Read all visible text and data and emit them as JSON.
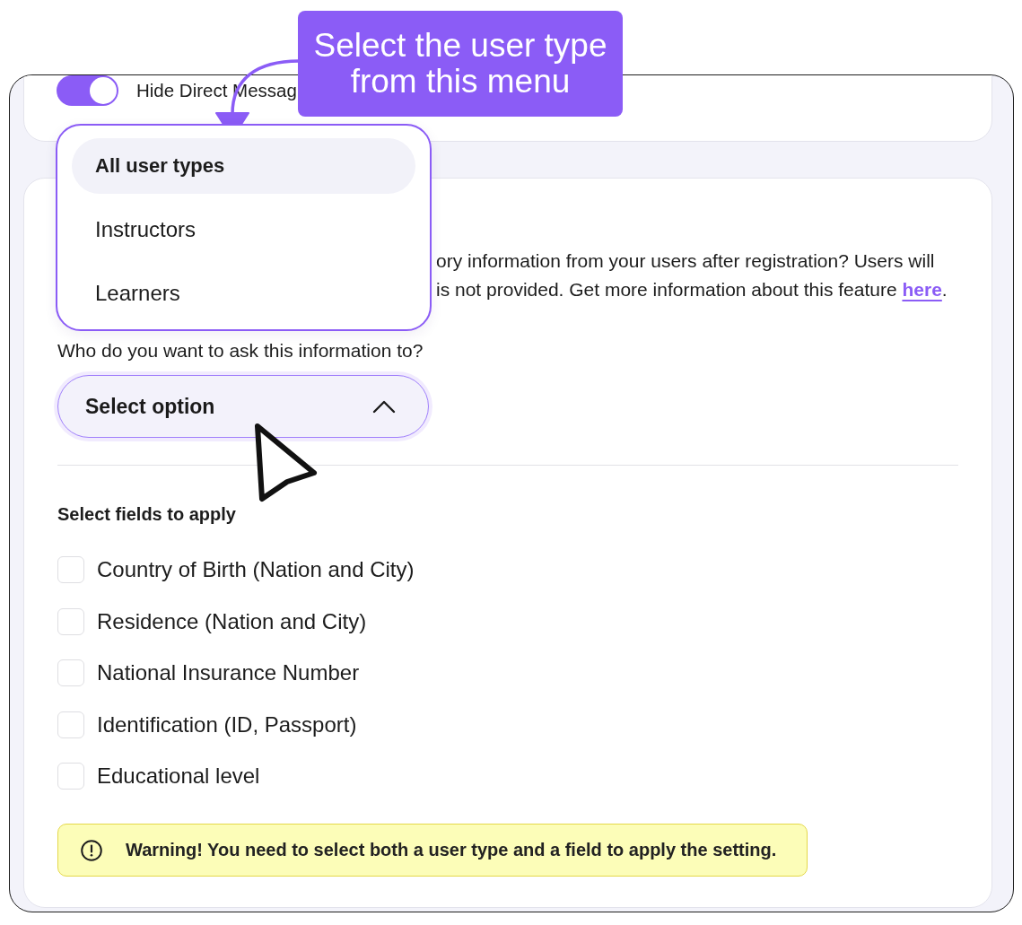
{
  "tooltip": {
    "text": "Select the user type from this menu"
  },
  "top_card": {
    "toggle": {
      "on": true
    },
    "label": "Hide Direct Messag"
  },
  "settings": {
    "description": {
      "lines": [
        "ory information from your users after registration? Users will",
        "is not provided. Get more information about this feature"
      ],
      "link": "here",
      "end": "."
    },
    "question": "Who do you want to ask this information to?",
    "select": {
      "label": "Select option",
      "expanded": true,
      "options": [
        {
          "label": "All user types",
          "selected": true
        },
        {
          "label": "Instructors",
          "selected": false
        },
        {
          "label": "Learners",
          "selected": false
        }
      ]
    },
    "fields_title": "Select fields to apply",
    "fields": [
      {
        "label": "Country of Birth (Nation and City)",
        "checked": false
      },
      {
        "label": "Residence (Nation and City)",
        "checked": false
      },
      {
        "label": "National Insurance Number",
        "checked": false
      },
      {
        "label": "Identification (ID, Passport)",
        "checked": false
      },
      {
        "label": "Educational level",
        "checked": false
      }
    ],
    "warning": {
      "text": "Warning! You need to select both a user type and a field to apply the setting."
    }
  }
}
